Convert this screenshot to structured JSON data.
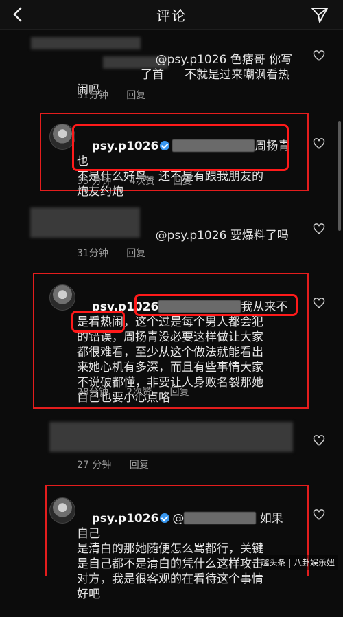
{
  "header": {
    "title": "评论"
  },
  "comments": [
    {
      "pre": "",
      "text": "@psy.p1026 色痞哥 你写\n了首",
      "cont": " 不就是过来嘲讽看热\n闹吗",
      "time": "51分钟",
      "reply": "回复"
    },
    {
      "user": "psy.p1026",
      "pre": "",
      "text": "周扬青也\n不是什么好鸟，还不是有跟我朋友的\n炮友约炮",
      "time": "35 分钟",
      "likes": "4次赞",
      "reply": "回复"
    },
    {
      "text": "@psy.p1026 要爆料了吗",
      "time": "31分钟",
      "reply": "回复"
    },
    {
      "user": "psy.p1026",
      "text": "我从来不\n是看热闹，这个过是每个男人都会犯\n的错误，周扬青没必要这样做让大家\n都很难看，至少从这个做法就能看出\n来她心机有多深，而且有些事情大家\n不说破都懂，非要让人身败名裂那她\n自己也要小心点咯",
      "time": "28分钟",
      "likes": "2次赞",
      "reply": "回复"
    },
    {
      "time": "27 分钟",
      "reply": "回复"
    },
    {
      "user": "psy.p1026",
      "mention": "@",
      "text": " 如果自己\n是清白的那她随便怎么骂都行，关键\n是自己都不是清白的凭什么这样攻击\n对方，我是很客观的在看待这个事情\n好吧"
    }
  ],
  "watermark": "趣头条 | 八卦娱乐妞"
}
